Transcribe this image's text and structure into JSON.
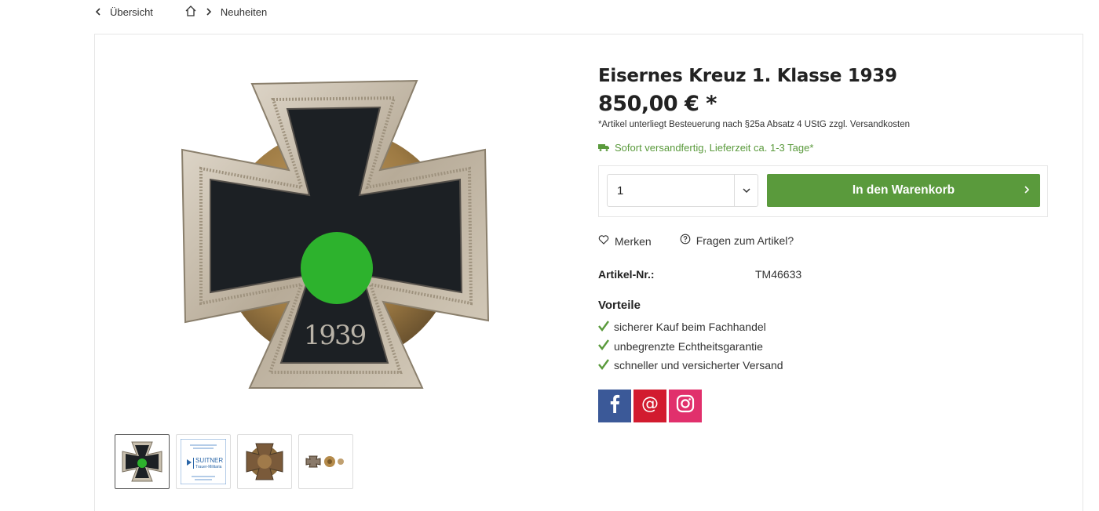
{
  "nav": {
    "back_label": "Übersicht",
    "breadcrumb": {
      "category": "Neuheiten"
    }
  },
  "product": {
    "title": "Eisernes Kreuz 1. Klasse 1939",
    "price": "850,00 € *",
    "tax_note": "*Artikel unterliegt Besteuerung nach §25a Absatz 4 UStG zzgl. Versandkosten",
    "delivery": "Sofort versandfertig, Lieferzeit ca. 1-3 Tage*",
    "image_year": "1939"
  },
  "buybox": {
    "quantity": "1",
    "cart_button": "In den Warenkorb"
  },
  "actions": {
    "merken": "Merken",
    "fragen": "Fragen zum Artikel?"
  },
  "details": {
    "artnr_label": "Artikel-Nr.:",
    "artnr_value": "TM46633"
  },
  "vorteile": {
    "title": "Vorteile",
    "items": [
      "sicherer Kauf beim Fachhandel",
      "unbegrenzte Echtheitsgarantie",
      "schneller und versicherter Versand"
    ]
  },
  "thumbnails": {
    "logo_text": "SUITNER",
    "logo_sub": "Trauer-Militaria"
  },
  "colors": {
    "accent_green": "#5a9a3c",
    "facebook": "#3b5998",
    "mail": "#d21b2f",
    "instagram": "#e1306c"
  }
}
